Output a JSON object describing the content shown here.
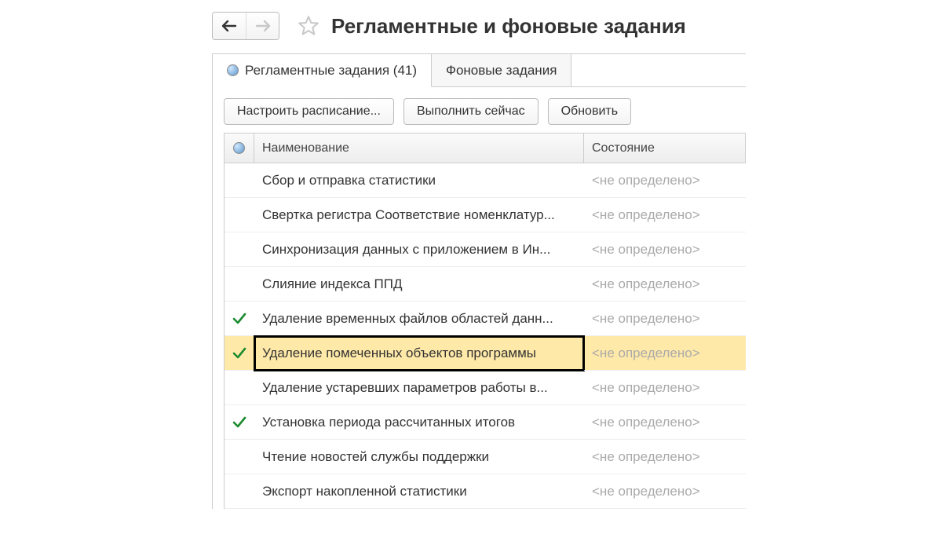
{
  "header": {
    "title": "Регламентные и фоновые задания"
  },
  "tabs": {
    "scheduled": "Регламентные задания (41)",
    "background": "Фоновые задания"
  },
  "toolbar": {
    "configure_schedule": "Настроить расписание...",
    "run_now": "Выполнить сейчас",
    "refresh": "Обновить"
  },
  "columns": {
    "name": "Наименование",
    "state": "Состояние"
  },
  "state_undefined": "<не определено>",
  "rows": [
    {
      "checked": false,
      "name": "Сбор и отправка статистики",
      "selected": false
    },
    {
      "checked": false,
      "name": "Свертка регистра Соответствие номенклатур...",
      "selected": false
    },
    {
      "checked": false,
      "name": "Синхронизация данных с приложением в Ин...",
      "selected": false
    },
    {
      "checked": false,
      "name": "Слияние индекса ППД",
      "selected": false
    },
    {
      "checked": true,
      "name": "Удаление временных файлов областей данн...",
      "selected": false
    },
    {
      "checked": true,
      "name": "Удаление помеченных объектов программы",
      "selected": true
    },
    {
      "checked": false,
      "name": "Удаление устаревших параметров работы в...",
      "selected": false
    },
    {
      "checked": true,
      "name": "Установка периода рассчитанных итогов",
      "selected": false
    },
    {
      "checked": false,
      "name": "Чтение новостей службы поддержки",
      "selected": false
    },
    {
      "checked": false,
      "name": "Экспорт накопленной статистики",
      "selected": false
    }
  ]
}
